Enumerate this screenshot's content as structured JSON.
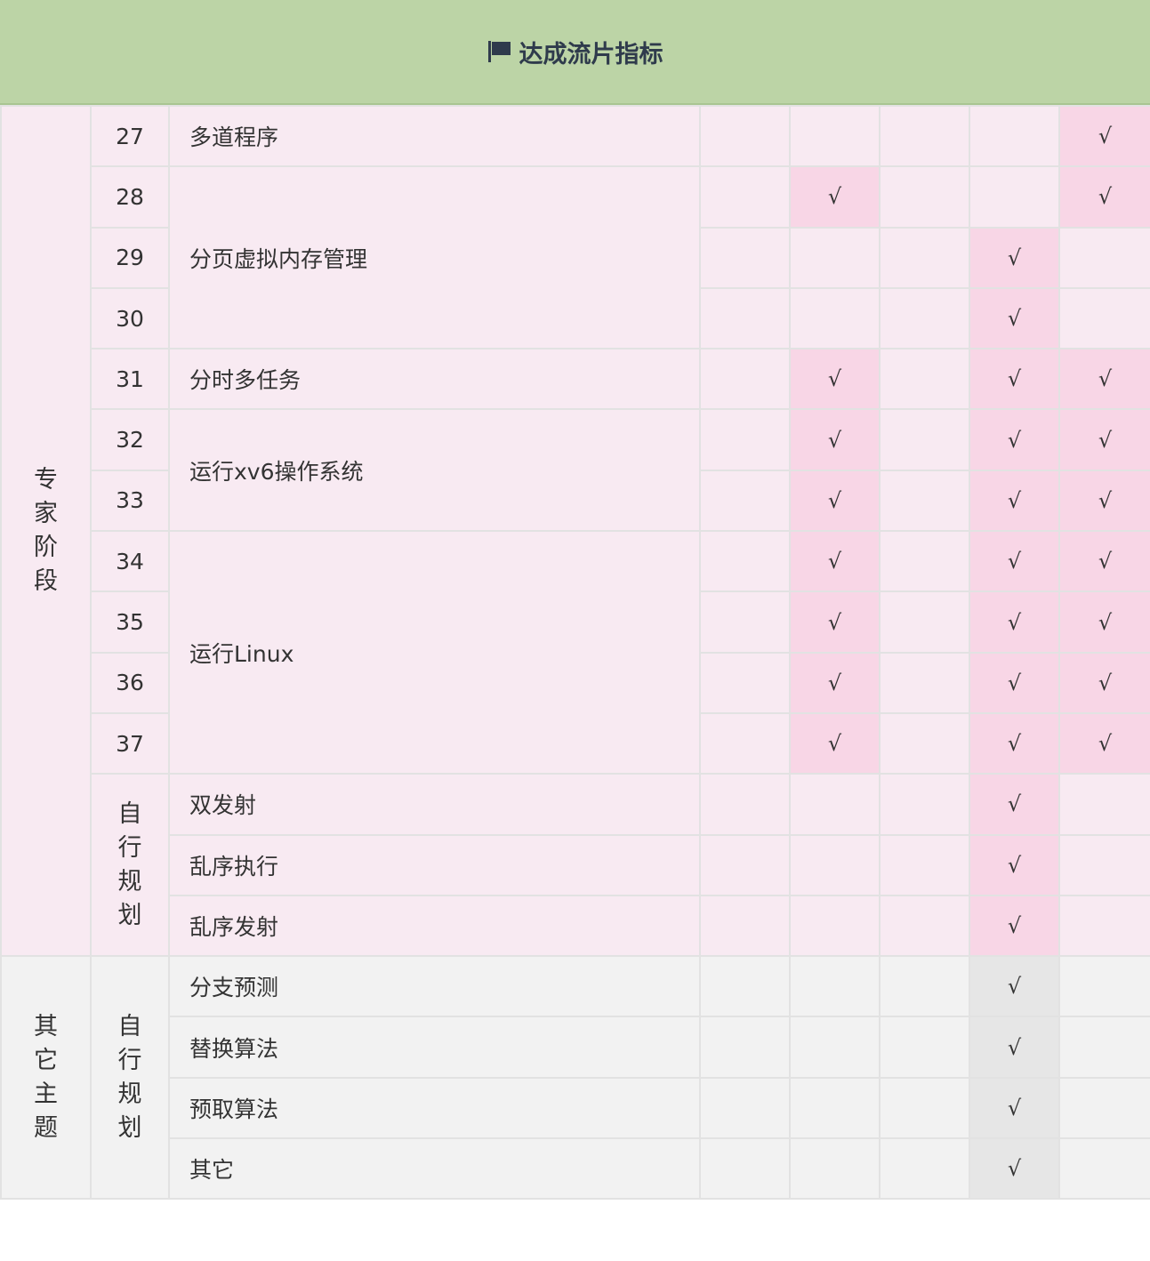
{
  "header": {
    "title": "达成流片指标",
    "icon": "flag-icon"
  },
  "check_mark": "√",
  "groups": [
    {
      "label": "专家阶段"
    },
    {
      "label": "其它主题"
    }
  ],
  "sub_groups": [
    {
      "label": "自行规划"
    },
    {
      "label": "自行规划"
    }
  ],
  "rows": [
    {
      "num": "27",
      "item": "多道程序",
      "checks": [
        false,
        false,
        false,
        false,
        true
      ]
    },
    {
      "num": "28",
      "item": "分页虚拟内存管理",
      "checks": [
        false,
        true,
        false,
        false,
        true
      ]
    },
    {
      "num": "29",
      "item": "",
      "checks": [
        false,
        false,
        false,
        true,
        false
      ]
    },
    {
      "num": "30",
      "item": "",
      "checks": [
        false,
        false,
        false,
        true,
        false
      ]
    },
    {
      "num": "31",
      "item": "分时多任务",
      "checks": [
        false,
        true,
        false,
        true,
        true
      ]
    },
    {
      "num": "32",
      "item": "运行xv6操作系统",
      "checks": [
        false,
        true,
        false,
        true,
        true
      ]
    },
    {
      "num": "33",
      "item": "",
      "checks": [
        false,
        true,
        false,
        true,
        true
      ]
    },
    {
      "num": "34",
      "item": "运行Linux",
      "checks": [
        false,
        true,
        false,
        true,
        true
      ]
    },
    {
      "num": "35",
      "item": "",
      "checks": [
        false,
        true,
        false,
        true,
        true
      ]
    },
    {
      "num": "36",
      "item": "",
      "checks": [
        false,
        true,
        false,
        true,
        true
      ]
    },
    {
      "num": "37",
      "item": "",
      "checks": [
        false,
        true,
        false,
        true,
        true
      ]
    },
    {
      "num": "",
      "item": "双发射",
      "checks": [
        false,
        false,
        false,
        true,
        false
      ]
    },
    {
      "num": "",
      "item": "乱序执行",
      "checks": [
        false,
        false,
        false,
        true,
        false
      ]
    },
    {
      "num": "",
      "item": "乱序发射",
      "checks": [
        false,
        false,
        false,
        true,
        false
      ]
    },
    {
      "num": "",
      "item": "分支预测",
      "checks": [
        false,
        false,
        false,
        true,
        false
      ]
    },
    {
      "num": "",
      "item": "替换算法",
      "checks": [
        false,
        false,
        false,
        true,
        false
      ]
    },
    {
      "num": "",
      "item": "预取算法",
      "checks": [
        false,
        false,
        false,
        true,
        false
      ]
    },
    {
      "num": "",
      "item": "其它",
      "checks": [
        false,
        false,
        false,
        true,
        false
      ]
    }
  ],
  "colors": {
    "header_bg": "#bcd4a6",
    "pink_bg": "#f8eaf2",
    "pink_check_bg": "#f8d6e6",
    "grey_bg": "#f2f2f2",
    "grey_check_bg": "#e6e6e6"
  }
}
